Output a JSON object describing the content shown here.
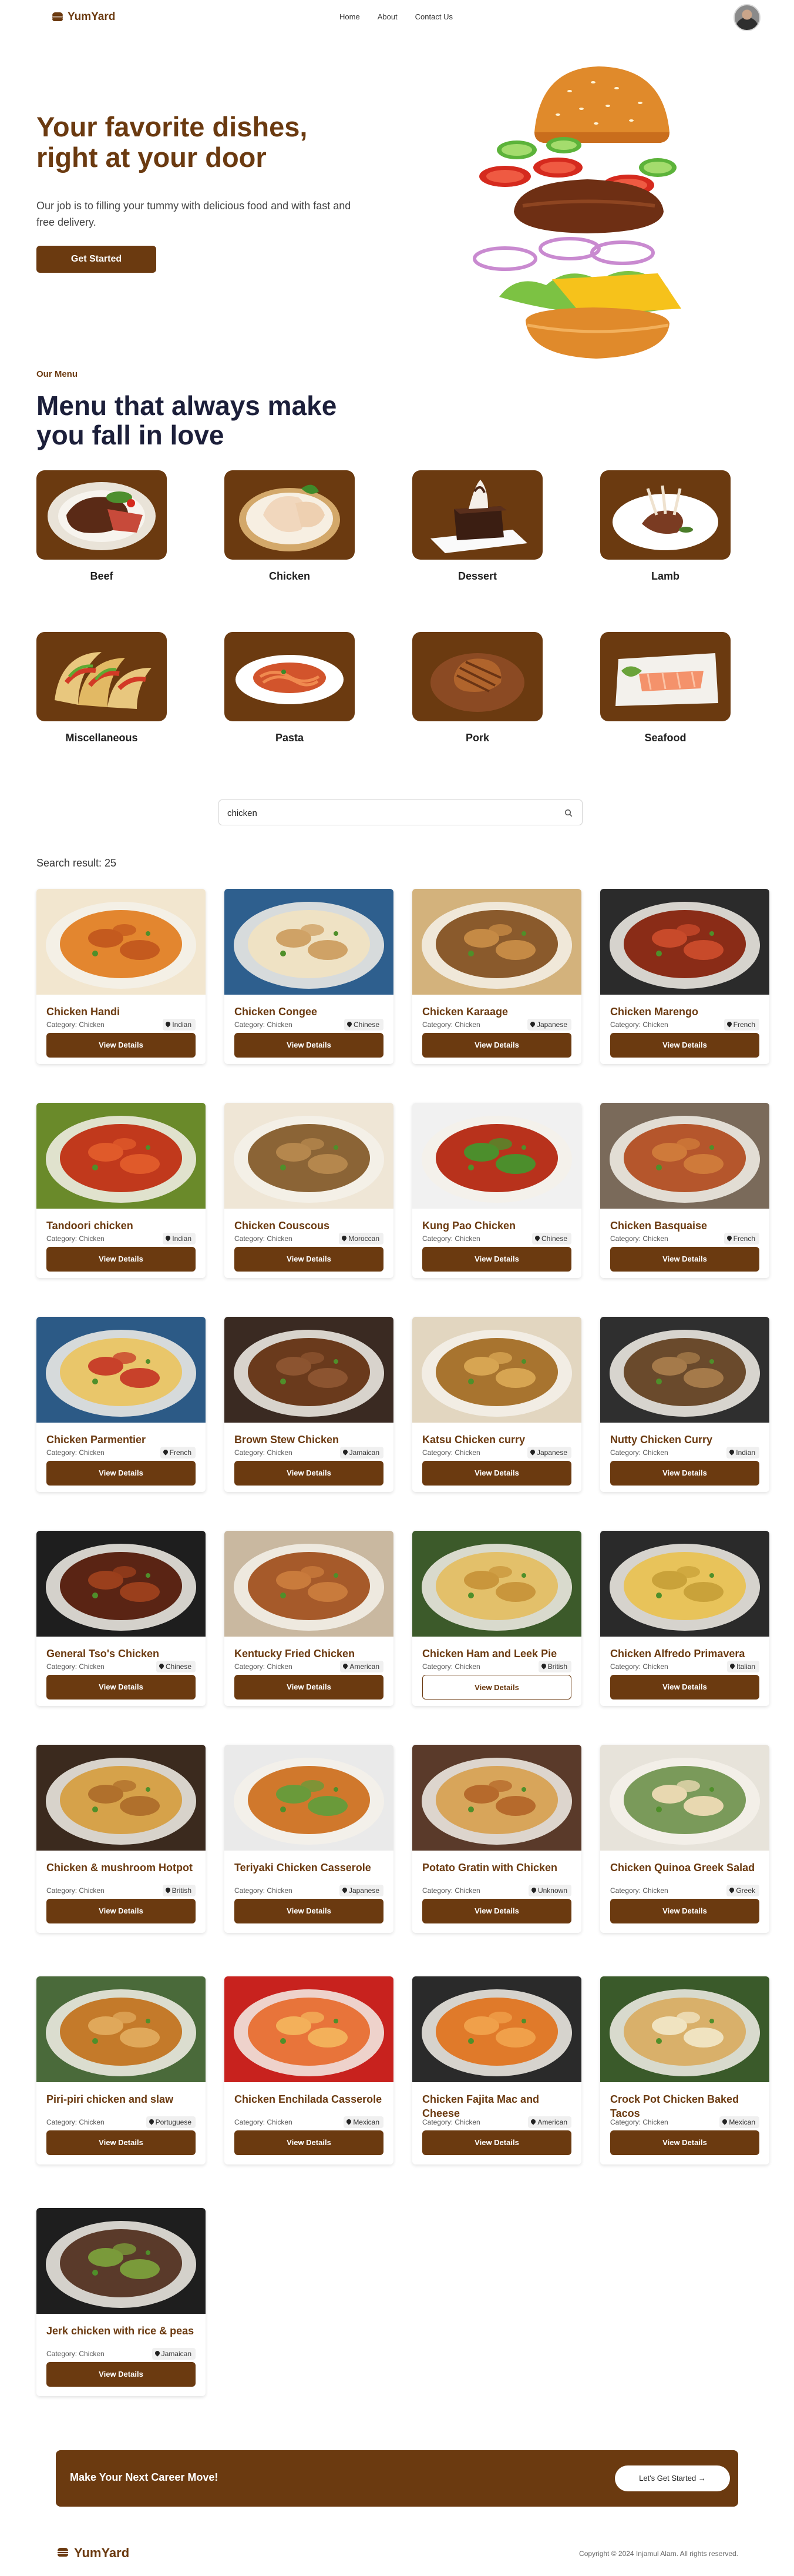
{
  "brand": {
    "name": "YumYard",
    "color": "#6b3a10"
  },
  "nav": {
    "links": [
      "Home",
      "About",
      "Contact Us"
    ],
    "avatar_icon": "user-avatar"
  },
  "hero": {
    "title": "Your favorite dishes, right at your door",
    "subtitle": "Our job is to filling your tummy with delicious food and with fast and free delivery.",
    "button": "Get Started",
    "image_icon": "burger-illustration"
  },
  "menu": {
    "kicker": "Our Menu",
    "title": "Menu that always make you fall in love",
    "categories": [
      {
        "label": "Beef",
        "icon": "steak-plate"
      },
      {
        "label": "Chicken",
        "icon": "chicken-plate"
      },
      {
        "label": "Dessert",
        "icon": "cake-plate"
      },
      {
        "label": "Lamb",
        "icon": "lamb-chops-plate"
      },
      {
        "label": "Miscellaneous",
        "icon": "tacos"
      },
      {
        "label": "Pasta",
        "icon": "pasta-bowl"
      },
      {
        "label": "Pork",
        "icon": "pork-steak"
      },
      {
        "label": "Seafood",
        "icon": "salmon-plate"
      }
    ]
  },
  "search": {
    "value": "chicken",
    "icon": "search-icon"
  },
  "results": {
    "label": "Search result: 25",
    "category_prefix": "Category: Chicken",
    "button": "View Details",
    "items": [
      {
        "name": "Chicken Handi",
        "area": "Indian"
      },
      {
        "name": "Chicken Congee",
        "area": "Chinese"
      },
      {
        "name": "Chicken Karaage",
        "area": "Japanese"
      },
      {
        "name": "Chicken Marengo",
        "area": "French"
      },
      {
        "name": "Tandoori chicken",
        "area": "Indian"
      },
      {
        "name": "Chicken Couscous",
        "area": "Moroccan"
      },
      {
        "name": "Kung Pao Chicken",
        "area": "Chinese"
      },
      {
        "name": "Chicken Basquaise",
        "area": "French"
      },
      {
        "name": "Chicken Parmentier",
        "area": "French"
      },
      {
        "name": "Brown Stew Chicken",
        "area": "Jamaican"
      },
      {
        "name": "Katsu Chicken curry",
        "area": "Japanese"
      },
      {
        "name": "Nutty Chicken Curry",
        "area": "Indian"
      },
      {
        "name": "General Tso's Chicken",
        "area": "Chinese"
      },
      {
        "name": "Kentucky Fried Chicken",
        "area": "American"
      },
      {
        "name": "Chicken Ham and Leek Pie",
        "area": "British"
      },
      {
        "name": "Chicken Alfredo Primavera",
        "area": "Italian"
      },
      {
        "name": "Chicken & mushroom Hotpot",
        "area": "British"
      },
      {
        "name": "Teriyaki Chicken Casserole",
        "area": "Japanese"
      },
      {
        "name": "Potato Gratin with Chicken",
        "area": "Unknown"
      },
      {
        "name": "Chicken Quinoa Greek Salad",
        "area": "Greek"
      },
      {
        "name": "Piri-piri chicken and slaw",
        "area": "Portuguese"
      },
      {
        "name": "Chicken Enchilada Casserole",
        "area": "Mexican"
      },
      {
        "name": "Chicken Fajita Mac and Cheese",
        "area": "American"
      },
      {
        "name": "Crock Pot Chicken Baked Tacos",
        "area": "Mexican"
      },
      {
        "name": "Jerk chicken with rice & peas",
        "area": "Jamaican"
      }
    ]
  },
  "cta": {
    "text": "Make Your Next Career Move!",
    "button": "Let's Get Started →"
  },
  "footer": {
    "copyright": "Copyright © 2024 Injamul Alam. All rights reserved."
  }
}
